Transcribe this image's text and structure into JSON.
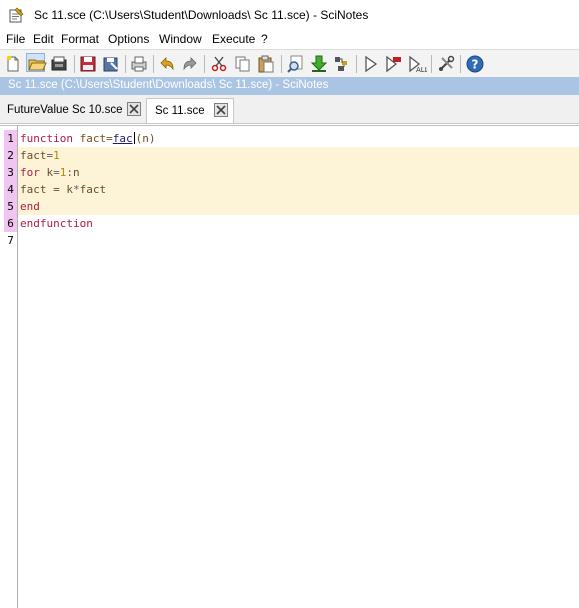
{
  "window": {
    "title": "Sc 11.sce (C:\\Users\\Student\\Downloads\\ Sc 11.sce) - SciNotes"
  },
  "menu": {
    "items": [
      "File",
      "Edit",
      "Format",
      "Options",
      "Window",
      "Execute",
      "?"
    ]
  },
  "toolbar": {
    "buttons": [
      {
        "name": "new-file-icon"
      },
      {
        "name": "open-file-icon"
      },
      {
        "name": "open-recent-icon"
      },
      {
        "name": "save-icon"
      },
      {
        "name": "save-as-icon"
      },
      {
        "name": "print-icon"
      },
      {
        "name": "print-preview-icon"
      },
      {
        "name": "undo-icon"
      },
      {
        "name": "redo-icon"
      },
      {
        "name": "cut-icon"
      },
      {
        "name": "copy-icon"
      },
      {
        "name": "paste-icon"
      },
      {
        "name": "find-icon"
      },
      {
        "name": "load-into-scilab-icon"
      },
      {
        "name": "save-and-execute-icon"
      },
      {
        "name": "execute-icon"
      },
      {
        "name": "execute-until-caret-icon"
      },
      {
        "name": "execute-selection-icon"
      },
      {
        "name": "preferences-icon"
      },
      {
        "name": "help-icon"
      }
    ]
  },
  "pathbar": {
    "text": "Sc 11.sce (C:\\Users\\Student\\Downloads\\ Sc 11.sce) - SciNotes"
  },
  "tabs": [
    {
      "label": "FutureValue Sc 10.sce",
      "active": false
    },
    {
      "label": "Sc 11.sce",
      "active": true
    }
  ],
  "editor": {
    "line_numbers": [
      "1",
      "2",
      "3",
      "4",
      "5",
      "6",
      "7"
    ],
    "code": {
      "l1": {
        "kw": "function",
        "rest_a": " fact=",
        "fname": "fac",
        "rest_b": "(n)"
      },
      "l2": {
        "var": "fact",
        "op": "=",
        "num": "1"
      },
      "l3": {
        "kw": "for",
        "var": " k",
        "op": "=",
        "num": "1",
        "colon": ":",
        "var2": "n"
      },
      "l4": {
        "text_a": "fact = k",
        "op": "*",
        "text_b": "fact"
      },
      "l5": {
        "kw": "end"
      },
      "l6": {
        "kw": "endfunction"
      }
    }
  },
  "colors": {
    "pathbar": "#a9c5e3",
    "function_body_bg": "#fdf3d7",
    "gutter_fn": "#f0c6f0",
    "keyword": "#b01a44"
  }
}
